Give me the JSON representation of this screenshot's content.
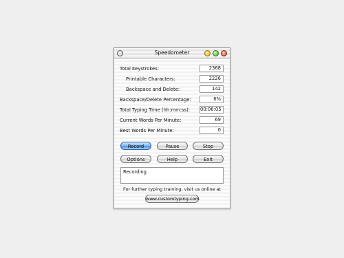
{
  "window": {
    "title": "Speedometer"
  },
  "stats": [
    {
      "label": "Total Keystrokes:",
      "value": "2368",
      "indent": false
    },
    {
      "label": "Printable Characters:",
      "value": "2226",
      "indent": true
    },
    {
      "label": "Backspace and Delete:",
      "value": "142",
      "indent": true
    },
    {
      "label": "Backspace/Delete Percentage:",
      "value": "6%",
      "indent": false
    },
    {
      "label": "Total Typing Time (hh:mm:ss):",
      "value": "00:06:05",
      "indent": false
    },
    {
      "label": "Current Words Per Minute:",
      "value": "69",
      "indent": false
    },
    {
      "label": "Best Words Per Minute:",
      "value": "0",
      "indent": false
    }
  ],
  "buttons": {
    "record": "Record",
    "pause": "Pause",
    "stop": "Stop",
    "options": "Options",
    "help": "Help",
    "exit": "Exit"
  },
  "status": {
    "text": "Recording"
  },
  "footer": {
    "text": "For further typing training, visit us online at",
    "link": "www.customtyping.com"
  },
  "colors": {
    "active_button": "#4a8fdc",
    "close": "#d23020",
    "minimize": "#e0a800",
    "zoom": "#3aa814"
  }
}
